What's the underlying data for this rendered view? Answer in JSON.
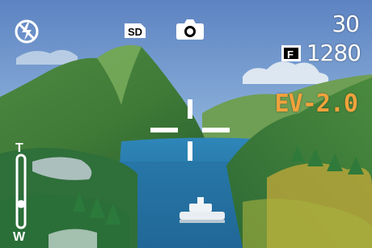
{
  "status": {
    "flash_icon": "flash-off-icon",
    "storage_icon": "sd-card-icon",
    "storage_label": "SD",
    "mode_icon": "camera-icon",
    "shots_remaining": "30",
    "resolution_icon": "fine-quality-icon",
    "resolution_badge": "F",
    "resolution": "1280"
  },
  "exposure": {
    "ev": "EV-2.0"
  },
  "zoom": {
    "tele_label": "T",
    "wide_label": "W",
    "position": 0.3
  },
  "focus": {
    "icon": "focus-frame-icon"
  },
  "colors": {
    "ev": "#f2a23c",
    "osd": "#ffffff"
  }
}
